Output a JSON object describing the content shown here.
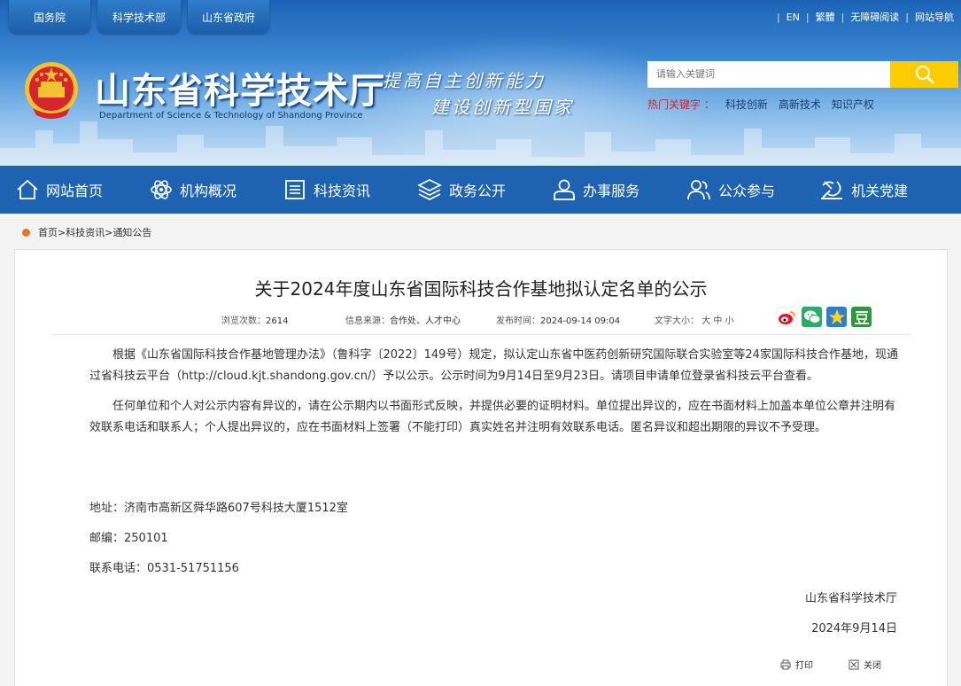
{
  "top_links": [
    "国务院",
    "科学技术部",
    "山东省政府"
  ],
  "util": [
    "EN",
    "繁體",
    "无障碍阅读",
    "网站导航"
  ],
  "site": {
    "title": "山东省科学技术厅",
    "subtitle": "Department of Science & Technology of Shandong Province",
    "slogan1": "提高自主创新能力",
    "slogan2": "建设创新型国家"
  },
  "search": {
    "placeholder": "请输入关键词"
  },
  "hot": {
    "label": "热门关键字 ：",
    "items": [
      "科技创新",
      "高新技术",
      "知识产权"
    ]
  },
  "nav": [
    {
      "label": "网站首页",
      "icon": "home-icon"
    },
    {
      "label": "机构概况",
      "icon": "atom-icon"
    },
    {
      "label": "科技资讯",
      "icon": "news-icon"
    },
    {
      "label": "政务公开",
      "icon": "layers-icon"
    },
    {
      "label": "办事服务",
      "icon": "user-service-icon"
    },
    {
      "label": "公众参与",
      "icon": "people-icon"
    },
    {
      "label": "机关党建",
      "icon": "party-icon"
    }
  ],
  "breadcrumb": [
    "首页",
    "科技资讯",
    "通知公告"
  ],
  "article": {
    "title": "关于2024年度山东省国际科技合作基地拟认定名单的公示",
    "views_label": "浏览次数：",
    "views": "2614",
    "source_label": "信息来源：",
    "source": "合作处、人才中心",
    "time_label": "发布时间：",
    "time": "2024-09-14 09:04",
    "fontsize_label": "文字大小：",
    "fontsize_options": [
      "大",
      "中",
      "小"
    ],
    "paragraphs": [
      "根据《山东省国际科技合作基地管理办法》（鲁科字〔2022〕149号）规定，拟认定山东省中医药创新研究国际联合实验室等24家国际科技合作基地，现通过省科技云平台（http://cloud.kjt.shandong.gov.cn/）予以公示。公示时间为9月14日至9月23日。请项目申请单位登录省科技云平台查看。",
      "任何单位和个人对公示内容有异议的，请在公示期内以书面形式反映，并提供必要的证明材料。单位提出异议的，应在书面材料上加盖本单位公章并注明有效联系电话和联系人；个人提出异议的，应在书面材料上签署（不能打印）真实姓名并注明有效联系电话。匿名异议和超出期限的异议不予受理。"
    ],
    "address": "地址：济南市高新区舜华路607号科技大厦1512室",
    "postcode": "邮编：250101",
    "phone": "联系电话：0531-51751156",
    "signer": "山东省科学技术厅",
    "date": "2024年9月14日",
    "print_label": "打印",
    "close_label": "关闭"
  },
  "colors": {
    "nav_bg": "#1d63b2",
    "search_btn": "#ffcc00",
    "hot_label": "#d4232b"
  }
}
